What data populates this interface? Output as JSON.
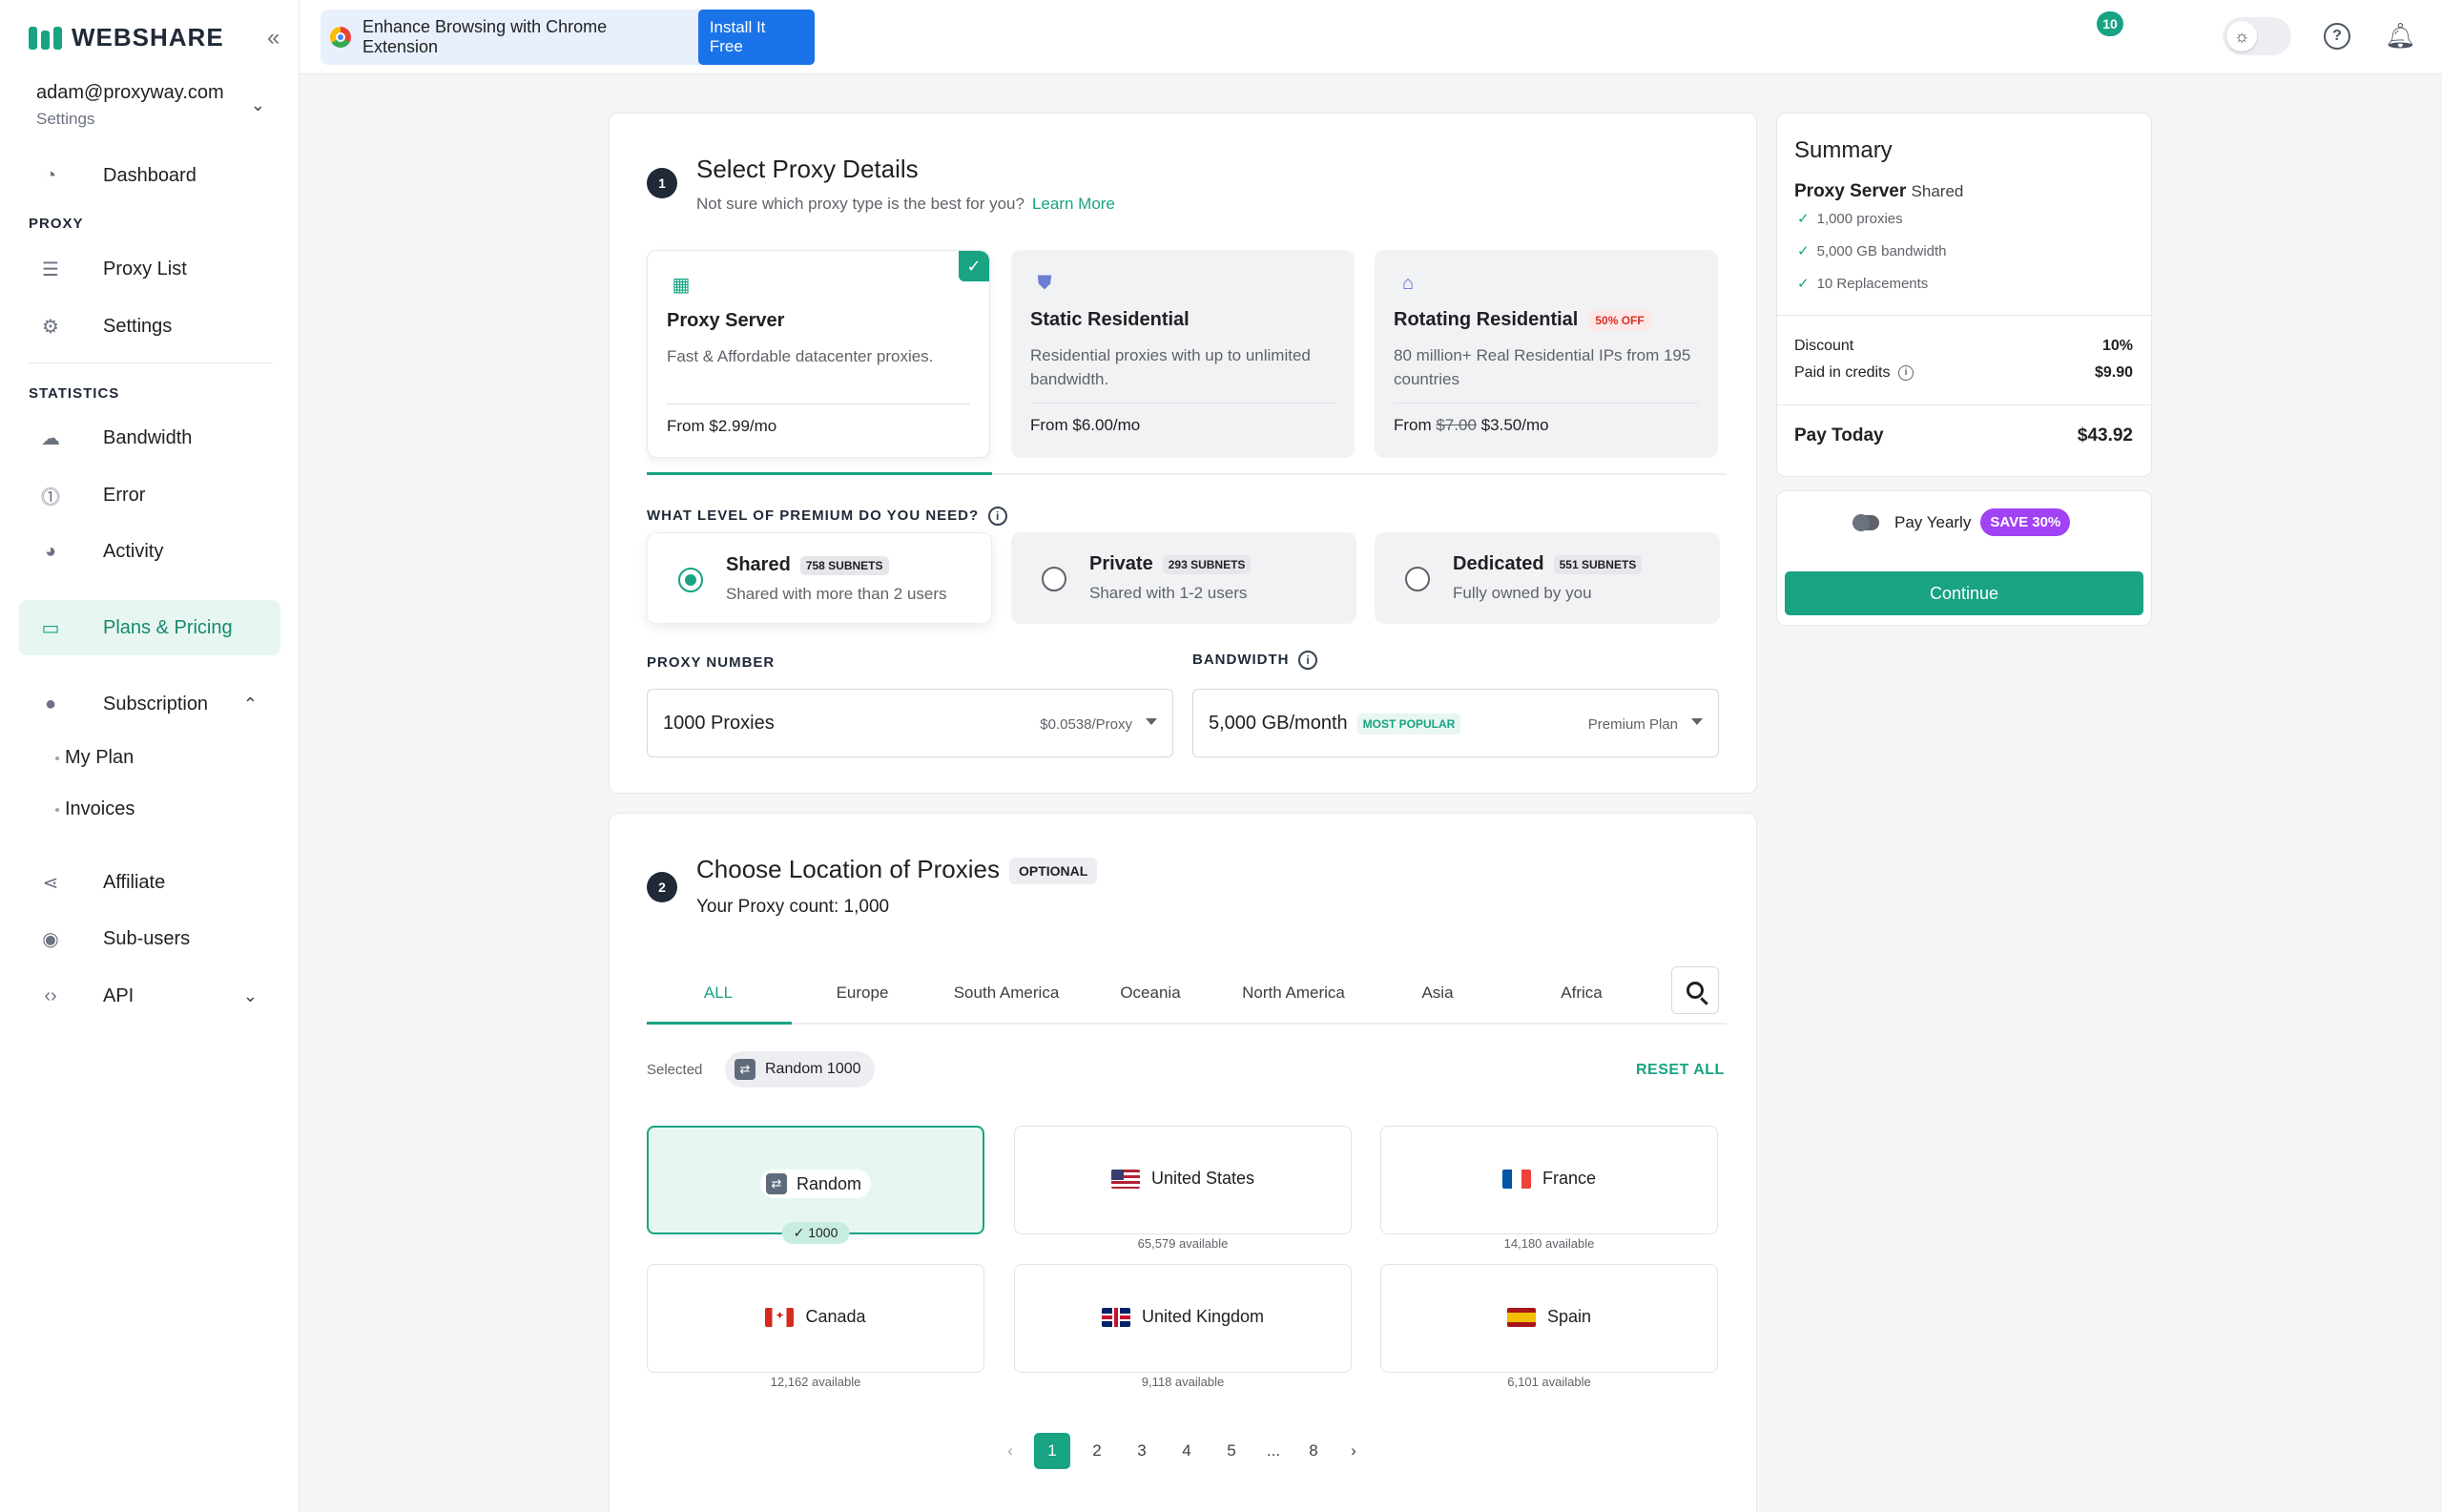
{
  "sidebar": {
    "logo_text": "WEBSHARE",
    "account": {
      "email": "adam@proxyway.com",
      "sub": "Settings"
    },
    "dashboard": "Dashboard",
    "section_proxy": "PROXY",
    "proxy_list": "Proxy List",
    "settings": "Settings",
    "section_statistics": "STATISTICS",
    "bandwidth": "Bandwidth",
    "error": "Error",
    "activity": "Activity",
    "plans_pricing": "Plans & Pricing",
    "subscription": "Subscription",
    "my_plan": "My Plan",
    "invoices": "Invoices",
    "affiliate": "Affiliate",
    "sub_users": "Sub-users",
    "api": "API"
  },
  "topbar": {
    "extension_text": "Enhance Browsing with Chrome Extension",
    "extension_button": "Install It Free",
    "notification_count": "10"
  },
  "step1": {
    "number": "1",
    "title": "Select Proxy Details",
    "subtitle": "Not sure which proxy type is the best for you?",
    "learn_more": "Learn More",
    "proxy_types": [
      {
        "name": "Proxy Server",
        "desc": "Fast & Affordable datacenter proxies.",
        "price": "From $2.99/mo"
      },
      {
        "name": "Static Residential",
        "desc": "Residential proxies with up to unlimited bandwidth.",
        "price": "From $6.00/mo"
      },
      {
        "name": "Rotating Residential",
        "badge": "50% OFF",
        "desc": "80 million+ Real Residential IPs from 195 countries",
        "price_prefix": "From",
        "price_old": "$7.00",
        "price_new": "$3.50/mo"
      }
    ],
    "premium_label": "WHAT LEVEL OF PREMIUM DO YOU NEED?",
    "tiers": [
      {
        "name": "Shared",
        "subnets": "758 SUBNETS",
        "desc": "Shared with more than 2 users"
      },
      {
        "name": "Private",
        "subnets": "293 SUBNETS",
        "desc": "Shared with 1-2 users"
      },
      {
        "name": "Dedicated",
        "subnets": "551 SUBNETS",
        "desc": "Fully owned by you"
      }
    ],
    "proxy_number_label": "PROXY NUMBER",
    "proxy_number_value": "1000 Proxies",
    "proxy_number_rate": "$0.0538/Proxy",
    "bandwidth_label": "BANDWIDTH",
    "bandwidth_value": "5,000 GB/month",
    "bandwidth_badge": "MOST POPULAR",
    "bandwidth_plan": "Premium Plan"
  },
  "step2": {
    "number": "2",
    "title": "Choose Location of Proxies",
    "optional": "OPTIONAL",
    "count_text": "Your Proxy count: 1,000",
    "tabs": [
      "ALL",
      "Europe",
      "South America",
      "Oceania",
      "North America",
      "Asia",
      "Africa"
    ],
    "selected_label": "Selected",
    "selected_chip": "Random 1000",
    "reset_all": "RESET ALL",
    "locations": [
      {
        "name": "Random",
        "count": "1000"
      },
      {
        "name": "United States",
        "available": "65,579 available"
      },
      {
        "name": "France",
        "available": "14,180 available"
      },
      {
        "name": "Canada",
        "available": "12,162 available"
      },
      {
        "name": "United Kingdom",
        "available": "9,118 available"
      },
      {
        "name": "Spain",
        "available": "6,101 available"
      }
    ],
    "pages": [
      "1",
      "2",
      "3",
      "4",
      "5",
      "...",
      "8"
    ]
  },
  "summary": {
    "title": "Summary",
    "product": "Proxy Server",
    "product_tier": "Shared",
    "features": [
      "1,000 proxies",
      "5,000 GB bandwidth",
      "10 Replacements"
    ],
    "discount_label": "Discount",
    "discount_value": "10%",
    "credits_label": "Paid in credits",
    "credits_value": "$9.90",
    "pay_today_label": "Pay Today",
    "pay_today_value": "$43.92",
    "pay_yearly": "Pay Yearly",
    "save_badge": "SAVE 30%",
    "continue": "Continue"
  },
  "colors": {
    "accent": "#18a383",
    "banner_button": "#1a73e8",
    "save_badge": "#a142f4",
    "off_badge": "#d93025"
  }
}
